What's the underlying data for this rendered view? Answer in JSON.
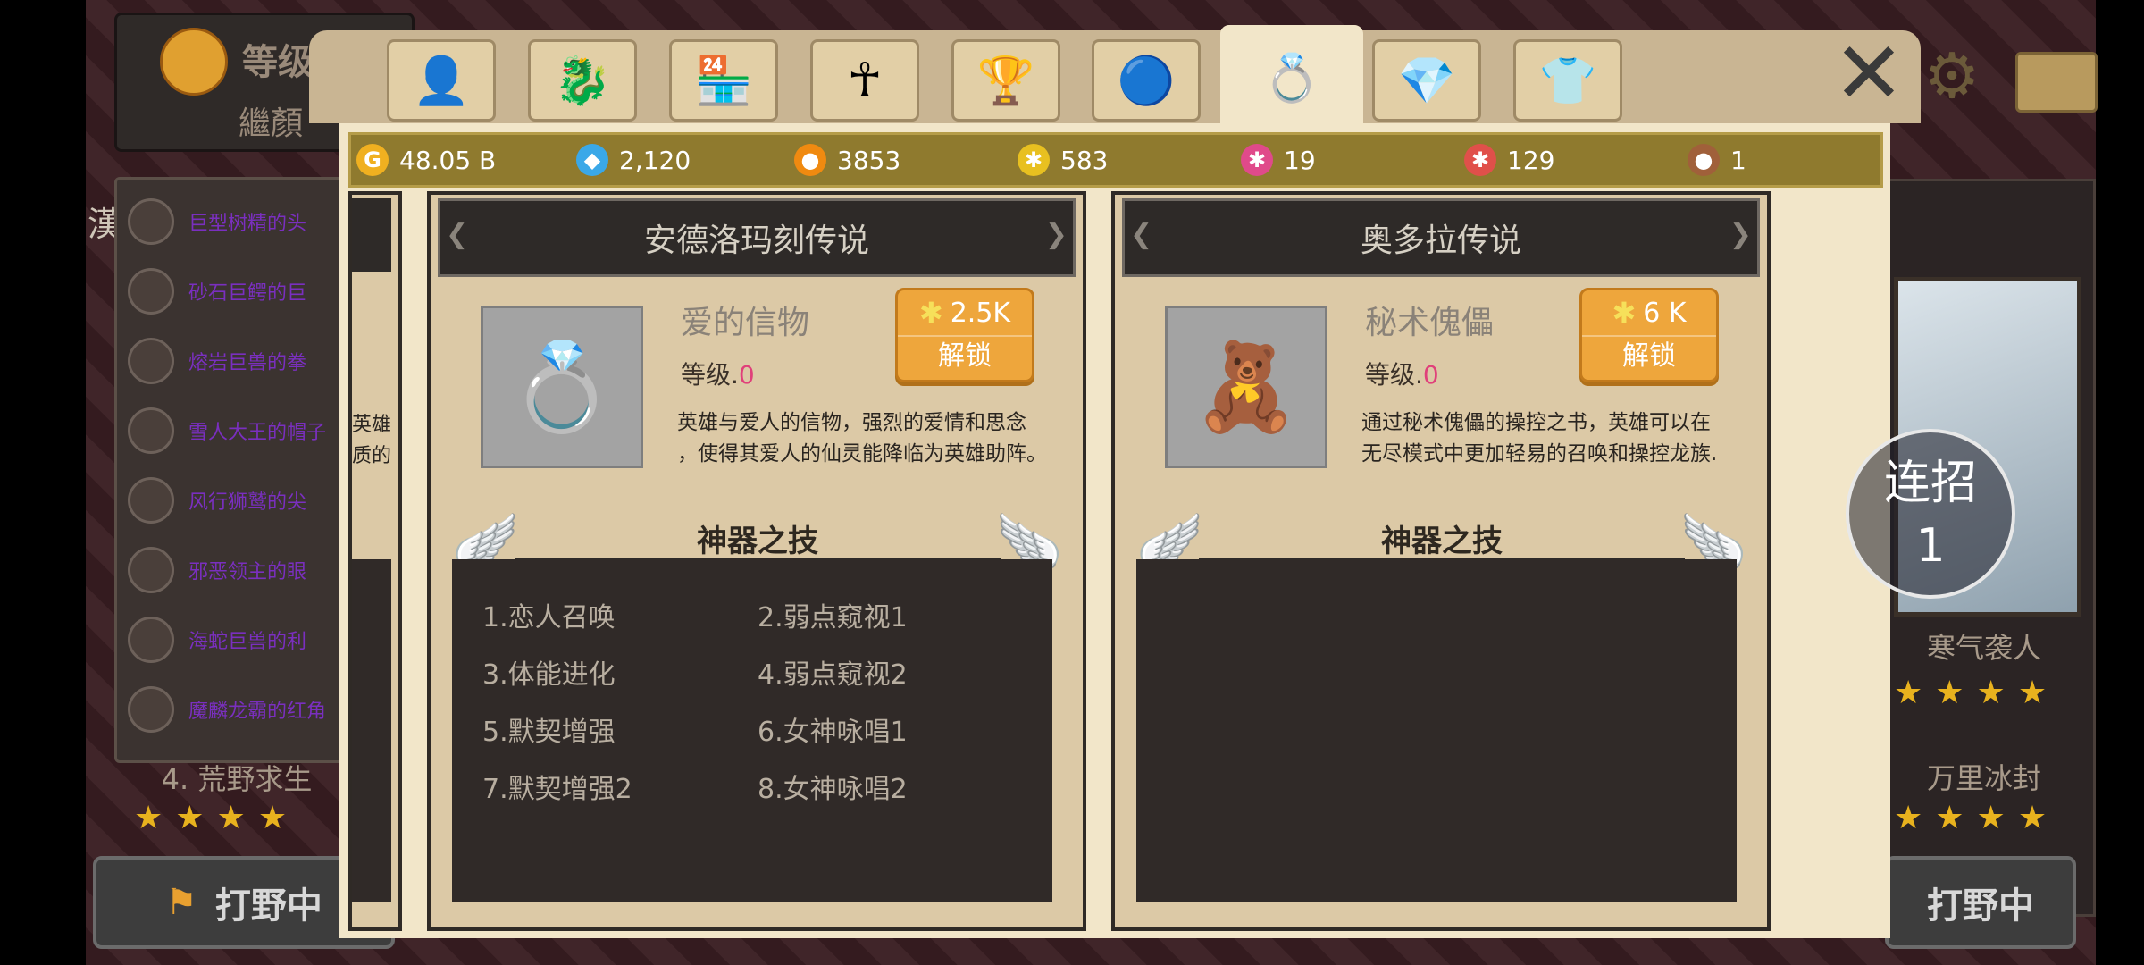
{
  "background": {
    "level_label": "等级",
    "sublabel": "繼顏",
    "side_char": "漢",
    "left_list": [
      "巨型树精的头",
      "砂石巨鳄的巨",
      "熔岩巨兽的拳",
      "雪人大王的帽子",
      "风行狮鹫的尖",
      "邪恶领主的眼",
      "海蛇巨兽的利",
      "魔麟龙霸的红角"
    ],
    "left_partial_desc": [
      "英雄",
      "质的"
    ],
    "left_stage": "4. 荒野求生",
    "left_button": "打野中",
    "right_stage_1": "寒气袭人",
    "right_stage_2": "万里冰封",
    "right_button": "打野中",
    "stars": "★★★★"
  },
  "tabs": [
    {
      "name": "hero-tab",
      "icon": "👤"
    },
    {
      "name": "beast-tab",
      "icon": "🐉"
    },
    {
      "name": "shop-tab",
      "icon": "🏪"
    },
    {
      "name": "ankh-tab",
      "icon": "☥"
    },
    {
      "name": "trophy-tab",
      "icon": "🏆"
    },
    {
      "name": "orb-tab",
      "icon": "🔵"
    },
    {
      "name": "artifact-tab",
      "icon": "💍"
    },
    {
      "name": "gem-tab",
      "icon": "💎"
    },
    {
      "name": "outfit-tab",
      "icon": "👕"
    }
  ],
  "active_tab_index": 6,
  "resources": [
    {
      "icon": "G",
      "value": "48.05 B",
      "color": "#f0b020"
    },
    {
      "icon": "◆",
      "value": "2,120",
      "color": "#3aa8e8"
    },
    {
      "icon": "●",
      "value": "3853",
      "color": "#f08a10"
    },
    {
      "icon": "✱",
      "value": "583",
      "color": "#e8c020"
    },
    {
      "icon": "✱",
      "value": "19",
      "color": "#e04a8a"
    },
    {
      "icon": "✱",
      "value": "129",
      "color": "#e0504a"
    },
    {
      "icon": "●",
      "value": "1",
      "color": "#a0603a"
    }
  ],
  "cards": [
    {
      "title": "安德洛玛刻传说",
      "item_name": "爱的信物",
      "item_icon": "💍",
      "level_label": "等级.",
      "level_value": "0",
      "cost": "2.5K",
      "unlock": "解锁",
      "desc": [
        "英雄与爱人的信物，强烈的爱情和思念",
        "，使得其爱人的仙灵能降临为英雄助阵。"
      ],
      "skill_title": "神器之技",
      "skills": [
        "1.恋人召唤",
        "2.弱点窥视1",
        "3.体能进化",
        "4.弱点窥视2",
        "5.默契增强",
        "6.女神咏唱1",
        "7.默契增强2",
        "8.女神咏唱2"
      ]
    },
    {
      "title": "奥多拉传说",
      "item_name": "秘术傀儡",
      "item_icon": "🧸",
      "level_label": "等级.",
      "level_value": "0",
      "cost": "6 K",
      "unlock": "解锁",
      "desc": [
        "通过秘术傀儡的操控之书，英雄可以在",
        "无尽模式中更加轻易的召唤和操控龙族."
      ],
      "skill_title": "神器之技",
      "skills": []
    }
  ],
  "combo": {
    "label": "连招",
    "value": "1"
  },
  "close_icon": "✕",
  "colors": {
    "accent": "#eea63c",
    "level_value": "#e0407a",
    "resource_bar": "#8f7a2e"
  }
}
